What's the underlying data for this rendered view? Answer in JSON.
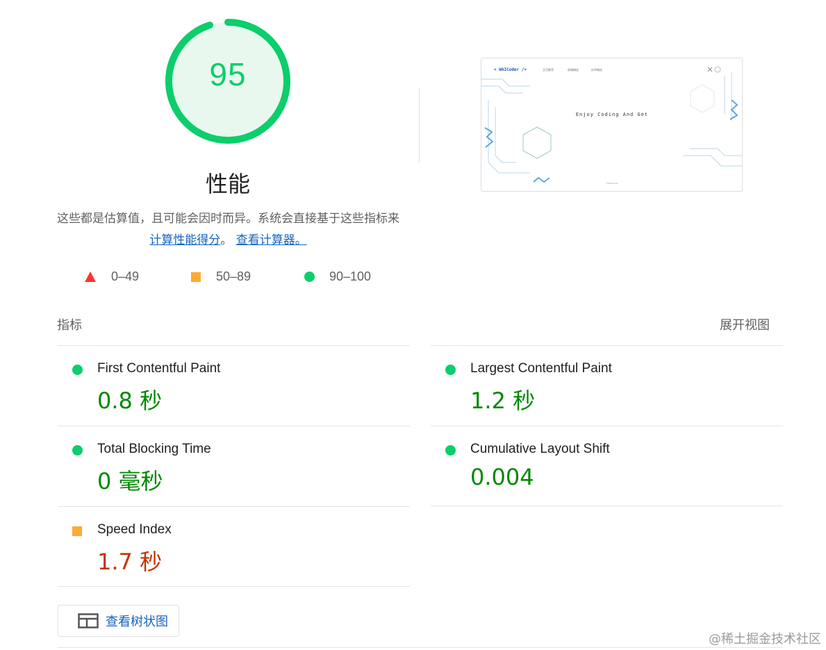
{
  "performance": {
    "score": "95",
    "score_fraction": 0.95,
    "title": "性能",
    "description_prefix": "这些都是估算值，且可能会因时而异。系统会直接基于这些指标来",
    "calc_link": "计算性能得分",
    "separator": "。",
    "view_calc_link": "查看计算器。",
    "legend": [
      {
        "icon": "triangle-fail-icon",
        "label": "0–49",
        "color": "#ff3333"
      },
      {
        "icon": "square-average-icon",
        "label": "50–89",
        "color": "#ffaa33"
      },
      {
        "icon": "circle-pass-icon",
        "label": "90–100",
        "color": "#0cce6b"
      }
    ]
  },
  "screenshot": {
    "brand": "< WAICoder />",
    "nav": [
      "主页推荐",
      "前端精选",
      "技术精选"
    ],
    "headline": "Enjoy Coding And Get",
    "footer": "©WAICoder"
  },
  "metrics": {
    "label": "指标",
    "expand_label": "展开视图",
    "items": [
      {
        "title": "First Contentful Paint",
        "value": "0.8 秒",
        "status": "pass",
        "color": "#008800"
      },
      {
        "title": "Largest Contentful Paint",
        "value": "1.2 秒",
        "status": "pass",
        "color": "#008800"
      },
      {
        "title": "Total Blocking Time",
        "value": "0 毫秒",
        "status": "pass",
        "color": "#008800"
      },
      {
        "title": "Cumulative Layout Shift",
        "value": "0.004",
        "status": "pass",
        "color": "#008800"
      },
      {
        "title": "Speed Index",
        "value": "1.7 秒",
        "status": "average",
        "color": "#c33300"
      }
    ]
  },
  "tree_button": {
    "label": "查看树状图",
    "icon": "treemap-icon"
  },
  "watermark": "@稀土掘金技术社区"
}
